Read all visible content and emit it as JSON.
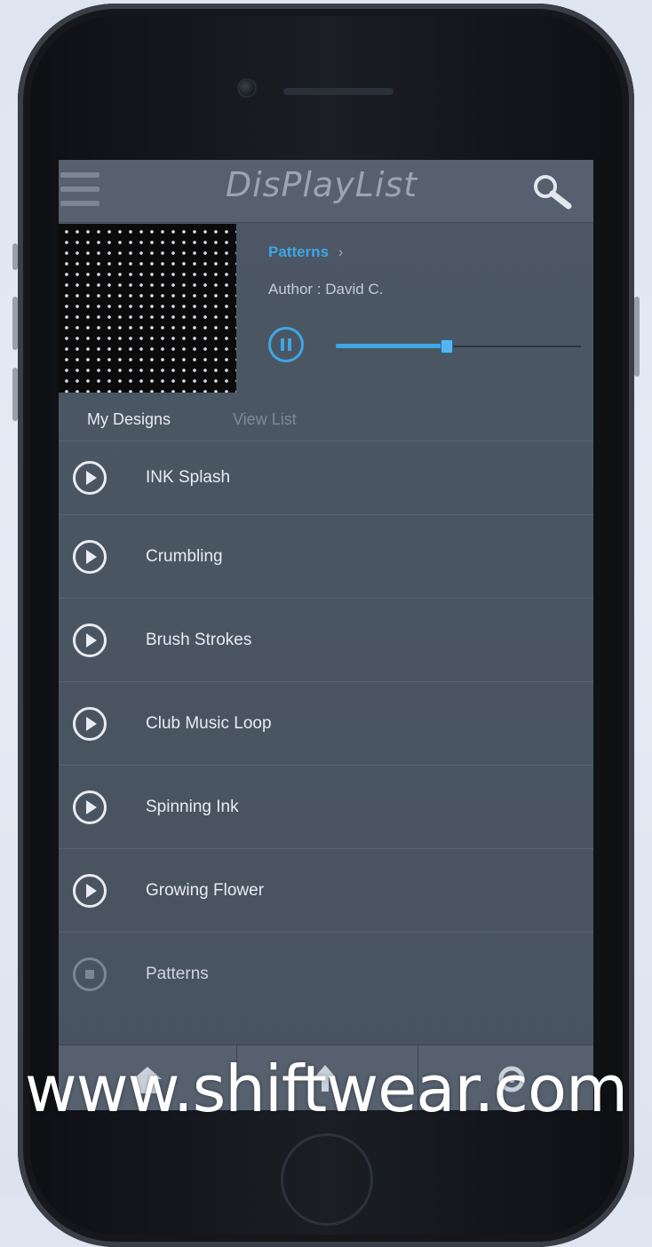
{
  "app": {
    "title": "DisPlayList"
  },
  "now_playing": {
    "title": "Patterns",
    "title_arrow": "›",
    "author": "Author : David C.",
    "progress": 0.45
  },
  "tabs": [
    {
      "label": "My Designs",
      "active": true
    },
    {
      "label": "View List",
      "active": false
    }
  ],
  "playlist": {
    "items": [
      {
        "label": "INK Splash",
        "state": "play"
      },
      {
        "label": "Crumbling",
        "state": "play"
      },
      {
        "label": "Brush Strokes",
        "state": "play"
      },
      {
        "label": "Club Music Loop",
        "state": "play"
      },
      {
        "label": "Spinning Ink",
        "state": "play"
      },
      {
        "label": "Growing Flower",
        "state": "play"
      },
      {
        "label": "Patterns",
        "state": "stop"
      }
    ]
  },
  "watermark": "www.shiftwear.com",
  "colors": {
    "accent": "#3fa6e6",
    "screen_bg": "#4a5562",
    "header_bg": "#56606e",
    "text_primary": "#e8ecf1"
  },
  "icons": {
    "menu": "hamburger-menu-icon",
    "search": "search-icon",
    "play": "play-circle-icon",
    "pause": "pause-circle-icon",
    "stop": "stop-circle-icon"
  }
}
